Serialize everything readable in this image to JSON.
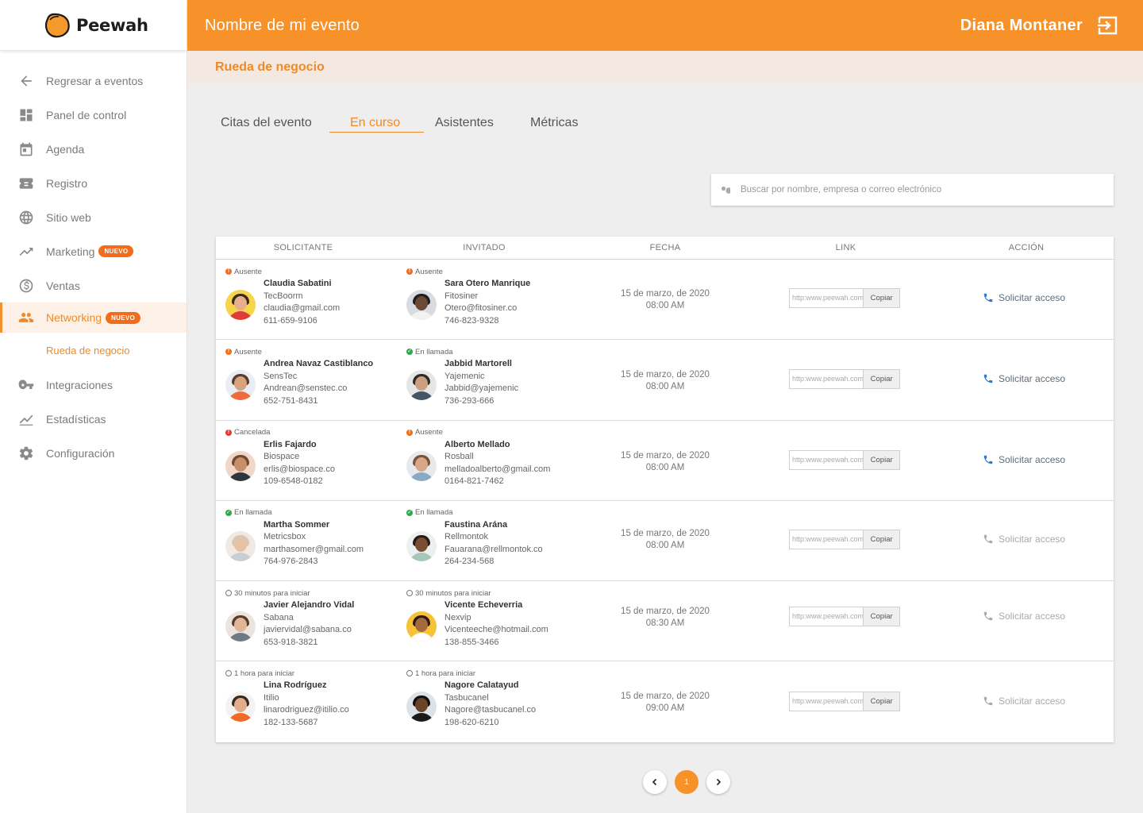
{
  "brand": {
    "name": "Peewah"
  },
  "header": {
    "event_title": "Nombre de mi evento",
    "user_name": "Diana Montaner"
  },
  "subheader": {
    "title": "Rueda de negocio"
  },
  "sidebar": {
    "items": [
      {
        "label": "Regresar a eventos"
      },
      {
        "label": "Panel de control"
      },
      {
        "label": "Agenda"
      },
      {
        "label": "Registro"
      },
      {
        "label": "Sitio web"
      },
      {
        "label": "Marketing",
        "badge": "NUEVO"
      },
      {
        "label": "Ventas"
      },
      {
        "label": "Networking",
        "badge": "NUEVO"
      },
      {
        "label": "Integraciones"
      },
      {
        "label": "Estadísticas"
      },
      {
        "label": "Configuración"
      }
    ],
    "subitem": "Rueda de negocio"
  },
  "tabs": [
    "Citas del evento",
    "En curso",
    "Asistentes",
    "Métricas"
  ],
  "search": {
    "placeholder": "Buscar por nombre, empresa o correo electrónico"
  },
  "table": {
    "headers": [
      "SOLICITANTE",
      "INVITADO",
      "FECHA",
      "LINK",
      "ACCIÓN"
    ],
    "rows": [
      {
        "solicitante": {
          "status": "Ausente",
          "name": "Claudia Sabatini",
          "company": "TecBoorm",
          "email": "claudia@gmail.com",
          "phone": "611-659-9106"
        },
        "invitado": {
          "status": "Ausente",
          "name": "Sara Otero Manrique",
          "company": "Fitosiner",
          "email": "Otero@fitosiner.co",
          "phone": "746-823-9328"
        },
        "date": "15 de marzo, de 2020",
        "time": "08:00 AM",
        "link": "http:www.peewah.com",
        "copy": "Copiar",
        "action": "Solicitar acceso"
      },
      {
        "solicitante": {
          "status": "Ausente",
          "name": "Andrea Navaz Castiblanco",
          "company": "SensTec",
          "email": "Andrean@senstec.co",
          "phone": "652-751-8431"
        },
        "invitado": {
          "status": "En llamada",
          "name": "Jabbid Martorell",
          "company": "Yajemenic",
          "email": "Jabbid@yajemenic",
          "phone": "736-293-666"
        },
        "date": "15 de marzo, de 2020",
        "time": "08:00 AM",
        "link": "http:www.peewah.com",
        "copy": "Copiar",
        "action": "Solicitar acceso"
      },
      {
        "solicitante": {
          "status": "Cancelada",
          "name": "Erlis Fajardo",
          "company": "Biospace",
          "email": "erlis@biospace.co",
          "phone": "109-6548-0182"
        },
        "invitado": {
          "status": "Ausente",
          "name": "Alberto Mellado",
          "company": "Rosball",
          "email": "melladoalberto@gmail.com",
          "phone": "0164-821-7462"
        },
        "date": "15 de marzo, de 2020",
        "time": "08:00 AM",
        "link": "http:www.peewah.com",
        "copy": "Copiar",
        "action": "Solicitar acceso"
      },
      {
        "solicitante": {
          "status": "En llamada",
          "name": "Martha Sommer",
          "company": "Metricsbox",
          "email": "marthasomer@gmail.com",
          "phone": "764-976-2843"
        },
        "invitado": {
          "status": "En llamada",
          "name": "Faustina Arána",
          "company": "Rellmontok",
          "email": "Fauarana@rellmontok.co",
          "phone": "264-234-568"
        },
        "date": "15 de marzo, de 2020",
        "time": "08:00 AM",
        "link": "http:www.peewah.com",
        "copy": "Copiar",
        "action": "Solicitar acceso"
      },
      {
        "solicitante": {
          "status": "30 minutos para iniciar",
          "name": "Javier Alejandro Vidal",
          "company": "Sabana",
          "email": "javiervidal@sabana.co",
          "phone": "653-918-3821"
        },
        "invitado": {
          "status": "30 minutos para iniciar",
          "name": "Vicente Echeverria",
          "company": "Nexvip",
          "email": "Vicenteeche@hotmail.com",
          "phone": "138-855-3466"
        },
        "date": "15 de marzo, de 2020",
        "time": "08:30 AM",
        "link": "http:www.peewah.com",
        "copy": "Copiar",
        "action": "Solicitar acceso"
      },
      {
        "solicitante": {
          "status": "1 hora para iniciar",
          "name": "Lina Rodríguez",
          "company": "Itilio",
          "email": "linarodriguez@itilio.co",
          "phone": "182-133-5687"
        },
        "invitado": {
          "status": "1 hora para iniciar",
          "name": "Nagore Calatayud",
          "company": "Tasbucanel",
          "email": "Nagore@tasbucanel.co",
          "phone": "198-620-6210"
        },
        "date": "15 de marzo, de 2020",
        "time": "09:00 AM",
        "link": "http:www.peewah.com",
        "copy": "Copiar",
        "action": "Solicitar acceso"
      }
    ]
  },
  "pagination": {
    "current": "1"
  },
  "colors": {
    "brand_orange": "#f7912a",
    "active_orange": "#f08a24",
    "badge": "#f36c1c",
    "status_absent": "#f36c1c",
    "status_cancelled": "#e53935",
    "status_call": "#2ea84a",
    "action_blue": "#2f78d0"
  }
}
